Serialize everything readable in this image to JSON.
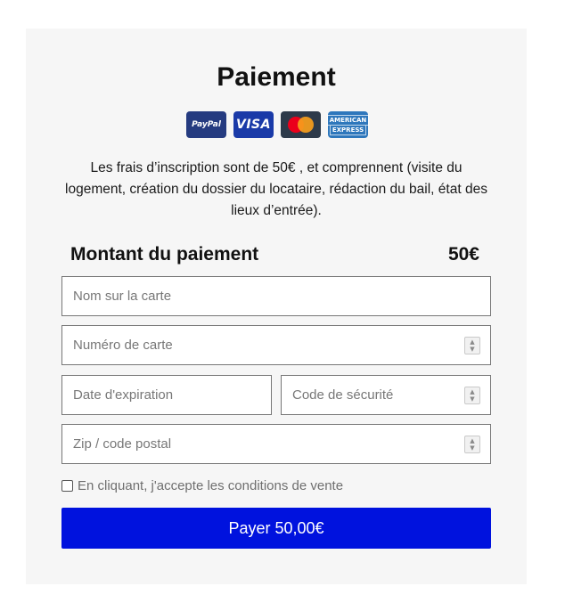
{
  "payment": {
    "title": "Paiement",
    "brands": {
      "paypal": "PayPal",
      "visa": "VISA",
      "amex_line1": "AMERICAN",
      "amex_line2": "EXPRESS"
    },
    "description": "Les frais d’inscription sont de 50€ , et comprennent (visite du logement, création du dossier du locataire, rédaction du bail, état des lieux d’entrée).",
    "amount_label": "Montant du paiement",
    "amount_value": "50€",
    "fields": {
      "card_name_placeholder": "Nom sur la carte",
      "card_number_placeholder": "Numéro de carte",
      "expiry_placeholder": "Date d'expiration",
      "security_code_placeholder": "Code de sécurité",
      "zip_placeholder": "Zip / code postal"
    },
    "terms_label": "En cliquant, j'accepte les conditions de vente",
    "terms_checked": false,
    "pay_button_label": "Payer 50,00€"
  },
  "colors": {
    "card_background": "#f6f6f6",
    "pay_button": "#0012de",
    "field_border": "#777777"
  }
}
